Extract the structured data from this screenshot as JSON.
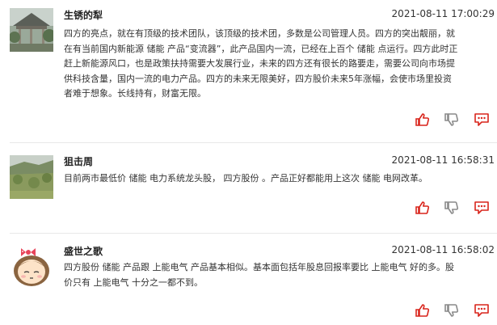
{
  "posts": [
    {
      "username": "生锈的犁",
      "timestamp": "2021-08-11 17:00:29",
      "lines": [
        "四方的亮点，就在有顶级的技术团队，该顶级的技术团，多数是公司管理人员。四方的突出靓丽，就",
        "在有当前国内新能源 储能 产品“变流器”，此产品国内一流，已经在上百个 储能 点运行。四方此时正",
        "赶上新能源风口，也是政策扶持需要大发展行业，未来的四方还有很长的路要走，需要公司向市场提",
        "供科技含量，国内一流的电力产品。四方的未来无限美好，四方股价未来5年涨幅，会使市场里投资",
        "者难于想象。长线持有，财富无限。"
      ],
      "avatar": "garden-pavilion-photo"
    },
    {
      "username": "狙击周",
      "timestamp": "2021-08-11 16:58:31",
      "lines": [
        "目前两市最低价 储能 电力系统龙头股， 四方股份 。产品正好都能用上这次 储能 电网改革。"
      ],
      "avatar": "hillside-landscape-photo"
    },
    {
      "username": "盛世之歌",
      "timestamp": "2021-08-11 16:58:02",
      "lines": [
        "四方股份 储能 产品跟 上能电气 产品基本相似。基本面包括年股息回报率要比 上能电气 好的多。股",
        "价只有 上能电气 十分之一都不到。"
      ],
      "avatar": "cartoon-girl-avatar"
    }
  ],
  "icons": {
    "like": "thumbs-up-icon",
    "dislike": "thumbs-down-icon",
    "comment": "comment-icon"
  },
  "colors": {
    "action_red": "#d9251c",
    "action_gray": "#8a8a8a",
    "divider": "#e8e8e8"
  }
}
